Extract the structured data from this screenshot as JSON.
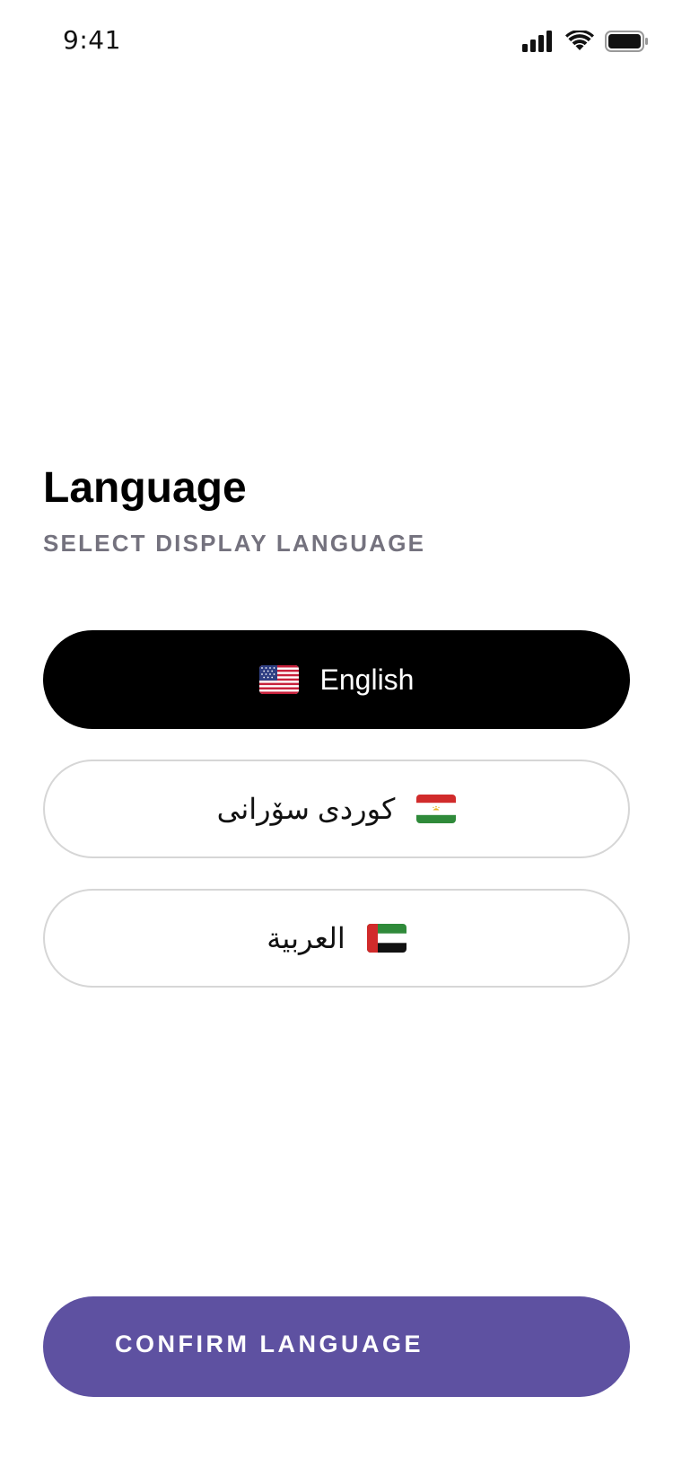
{
  "status_bar": {
    "time": "9:41",
    "icons": [
      "cellular-signal-icon",
      "wifi-icon",
      "battery-icon"
    ]
  },
  "header": {
    "title": "Language",
    "subtitle": "SELECT DISPLAY LANGUAGE"
  },
  "languages": [
    {
      "label": "English",
      "flag": "us-flag-icon",
      "selected": true
    },
    {
      "label": "کوردی سۆرانی",
      "flag": "tajikistan-flag-icon",
      "selected": false
    },
    {
      "label": "العربية",
      "flag": "uae-flag-icon",
      "selected": false
    }
  ],
  "confirm": {
    "label": "CONFIRM LANGUAGE"
  },
  "colors": {
    "accent": "#5e51a1",
    "selected_bg": "#000000",
    "subtitle": "#74727e",
    "option_border": "#d6d6d6"
  }
}
